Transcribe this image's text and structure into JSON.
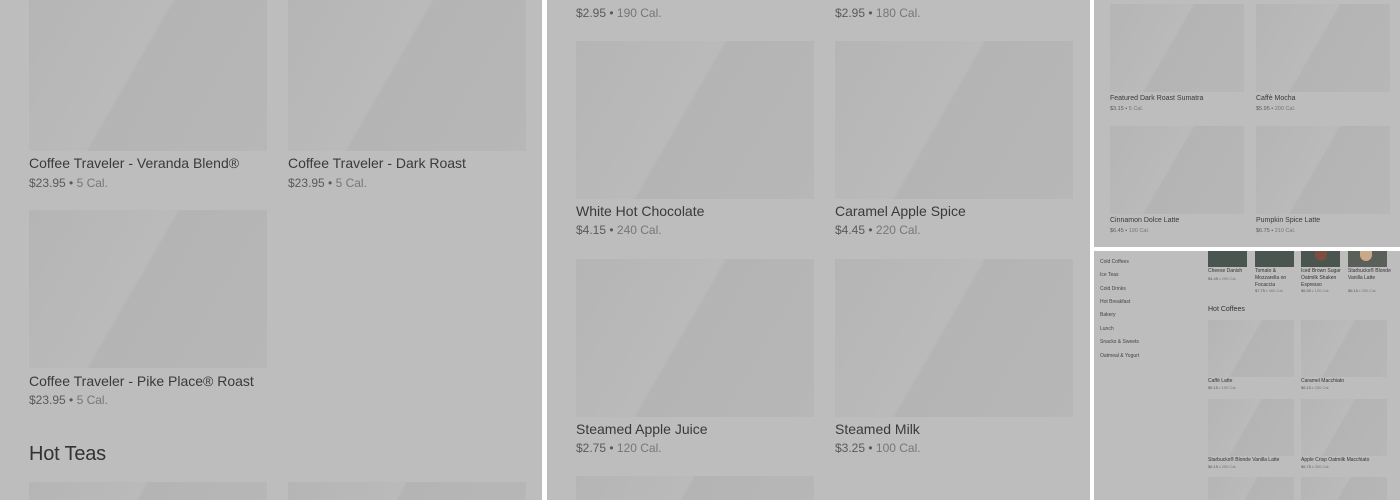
{
  "panel1": {
    "items": [
      {
        "name": "Coffee Traveler - Veranda Blend®",
        "price": "$23.95",
        "cal": "5 Cal."
      },
      {
        "name": "Coffee Traveler - Dark Roast",
        "price": "$23.95",
        "cal": "5 Cal."
      },
      {
        "name": "Coffee Traveler - Pike Place® Roast",
        "price": "$23.95",
        "cal": "5 Cal."
      }
    ],
    "heading": "Hot Teas"
  },
  "panel2": {
    "top": [
      {
        "price": "$2.95",
        "cal": "190 Cal."
      },
      {
        "price": "$2.95",
        "cal": "180 Cal."
      }
    ],
    "items": [
      {
        "name": "White Hot Chocolate",
        "price": "$4.15",
        "cal": "240 Cal."
      },
      {
        "name": "Caramel Apple Spice",
        "price": "$4.45",
        "cal": "220 Cal."
      },
      {
        "name": "Steamed Apple Juice",
        "price": "$2.75",
        "cal": "120 Cal."
      },
      {
        "name": "Steamed Milk",
        "price": "$3.25",
        "cal": "100 Cal."
      }
    ]
  },
  "panel3": {
    "items": [
      {
        "name": "Featured Dark Roast Sumatra",
        "price": "$3.15",
        "cal": "5 Cal."
      },
      {
        "name": "Caffè Mocha",
        "price": "$5.95",
        "cal": "200 Cal."
      },
      {
        "name": "Cinnamon Dolce Latte",
        "price": "$6.45",
        "cal": "190 Cal."
      },
      {
        "name": "Pumpkin Spice Latte",
        "price": "$6.75",
        "cal": "210 Cal."
      }
    ]
  },
  "panel4": {
    "sidebar": [
      "Cold Coffees",
      "Ice Teas",
      "Cold Drinks",
      "Hot Breakfast",
      "Bakery",
      "Lunch",
      "Snacks & Sweets",
      "Oatmeal & Yogurt"
    ],
    "top_items": [
      {
        "name": "Cheese Danish",
        "price": "$4.45",
        "cal": "290 Cal."
      },
      {
        "name": "Tomato & Mozzarella on Focaccia",
        "price": "$7.75",
        "cal": "360 Cal."
      },
      {
        "name": "Iced Brown Sugar Oatmilk Shaken Espresso",
        "price": "$6.55",
        "cal": "120 Cal."
      },
      {
        "name": "Starbucks® Blonde Vanilla Latte",
        "price": "$6.15",
        "cal": "250 Cal."
      }
    ],
    "heading": "Hot Coffees",
    "items": [
      {
        "name": "Caffè Latte",
        "price": "$5.15",
        "cal": "190 Cal."
      },
      {
        "name": "Caramel Macchiato",
        "price": "$6.15",
        "cal": "250 Cal."
      },
      {
        "name": "Starbucks® Blonde Vanilla Latte",
        "price": "$6.15",
        "cal": "250 Cal."
      },
      {
        "name": "Apple Crisp Oatmilk Macchiato",
        "price": "$6.75",
        "cal": "300 Cal."
      }
    ]
  }
}
